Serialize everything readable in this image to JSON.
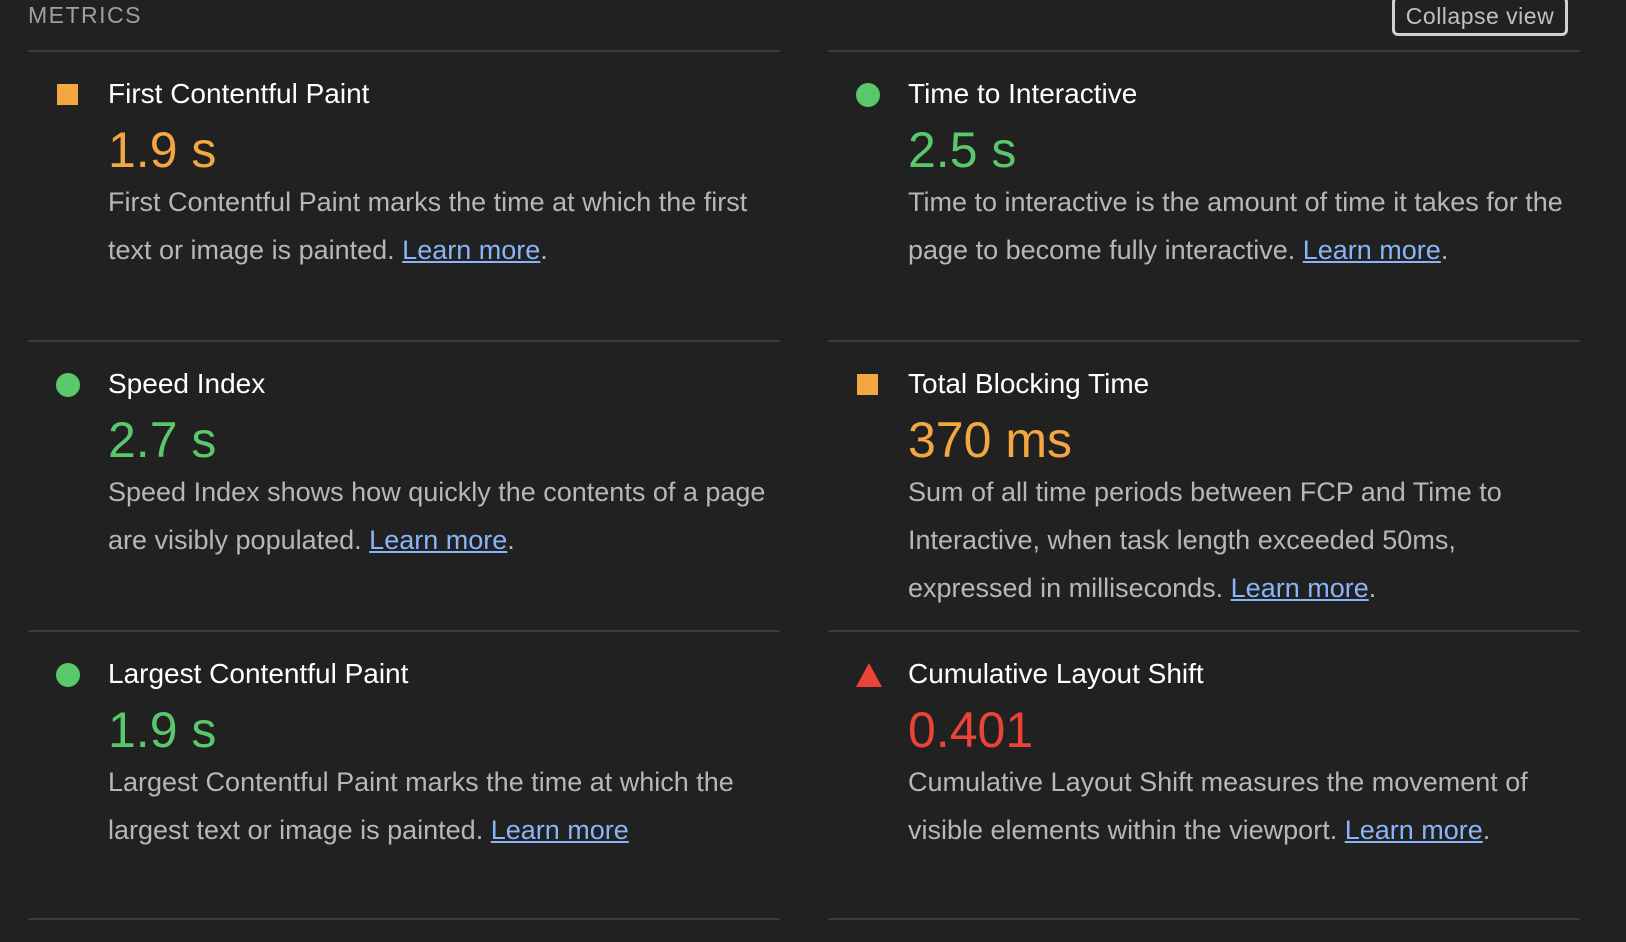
{
  "header": {
    "section_label": "METRICS",
    "collapse_label": "Collapse view"
  },
  "colors": {
    "average": "#f4a740",
    "pass": "#58c86a",
    "fail": "#eb4436",
    "link": "#8ab4f8"
  },
  "metrics": [
    {
      "title": "First Contentful Paint",
      "value": "1.9 s",
      "status": "average",
      "icon": "orange-square-icon",
      "description": "First Contentful Paint marks the time at which the first text or image is painted.",
      "link_label": "Learn more",
      "trailing": "."
    },
    {
      "title": "Time to Interactive",
      "value": "2.5 s",
      "status": "pass",
      "icon": "green-circle-icon",
      "description": "Time to interactive is the amount of time it takes for the page to become fully interactive.",
      "link_label": "Learn more",
      "trailing": "."
    },
    {
      "title": "Speed Index",
      "value": "2.7 s",
      "status": "pass",
      "icon": "green-circle-icon",
      "description": "Speed Index shows how quickly the contents of a page are visibly populated.",
      "link_label": "Learn more",
      "trailing": "."
    },
    {
      "title": "Total Blocking Time",
      "value": "370 ms",
      "status": "average",
      "icon": "orange-square-icon",
      "description": "Sum of all time periods between FCP and Time to Interactive, when task length exceeded 50ms, expressed in milliseconds.",
      "link_label": "Learn more",
      "trailing": "."
    },
    {
      "title": "Largest Contentful Paint",
      "value": "1.9 s",
      "status": "pass",
      "icon": "green-circle-icon",
      "description": "Largest Contentful Paint marks the time at which the largest text or image is painted.",
      "link_label": "Learn more",
      "trailing": ""
    },
    {
      "title": "Cumulative Layout Shift",
      "value": "0.401",
      "status": "fail",
      "icon": "red-triangle-icon",
      "description": "Cumulative Layout Shift measures the movement of visible elements within the viewport.",
      "link_label": "Learn more",
      "trailing": "."
    }
  ]
}
